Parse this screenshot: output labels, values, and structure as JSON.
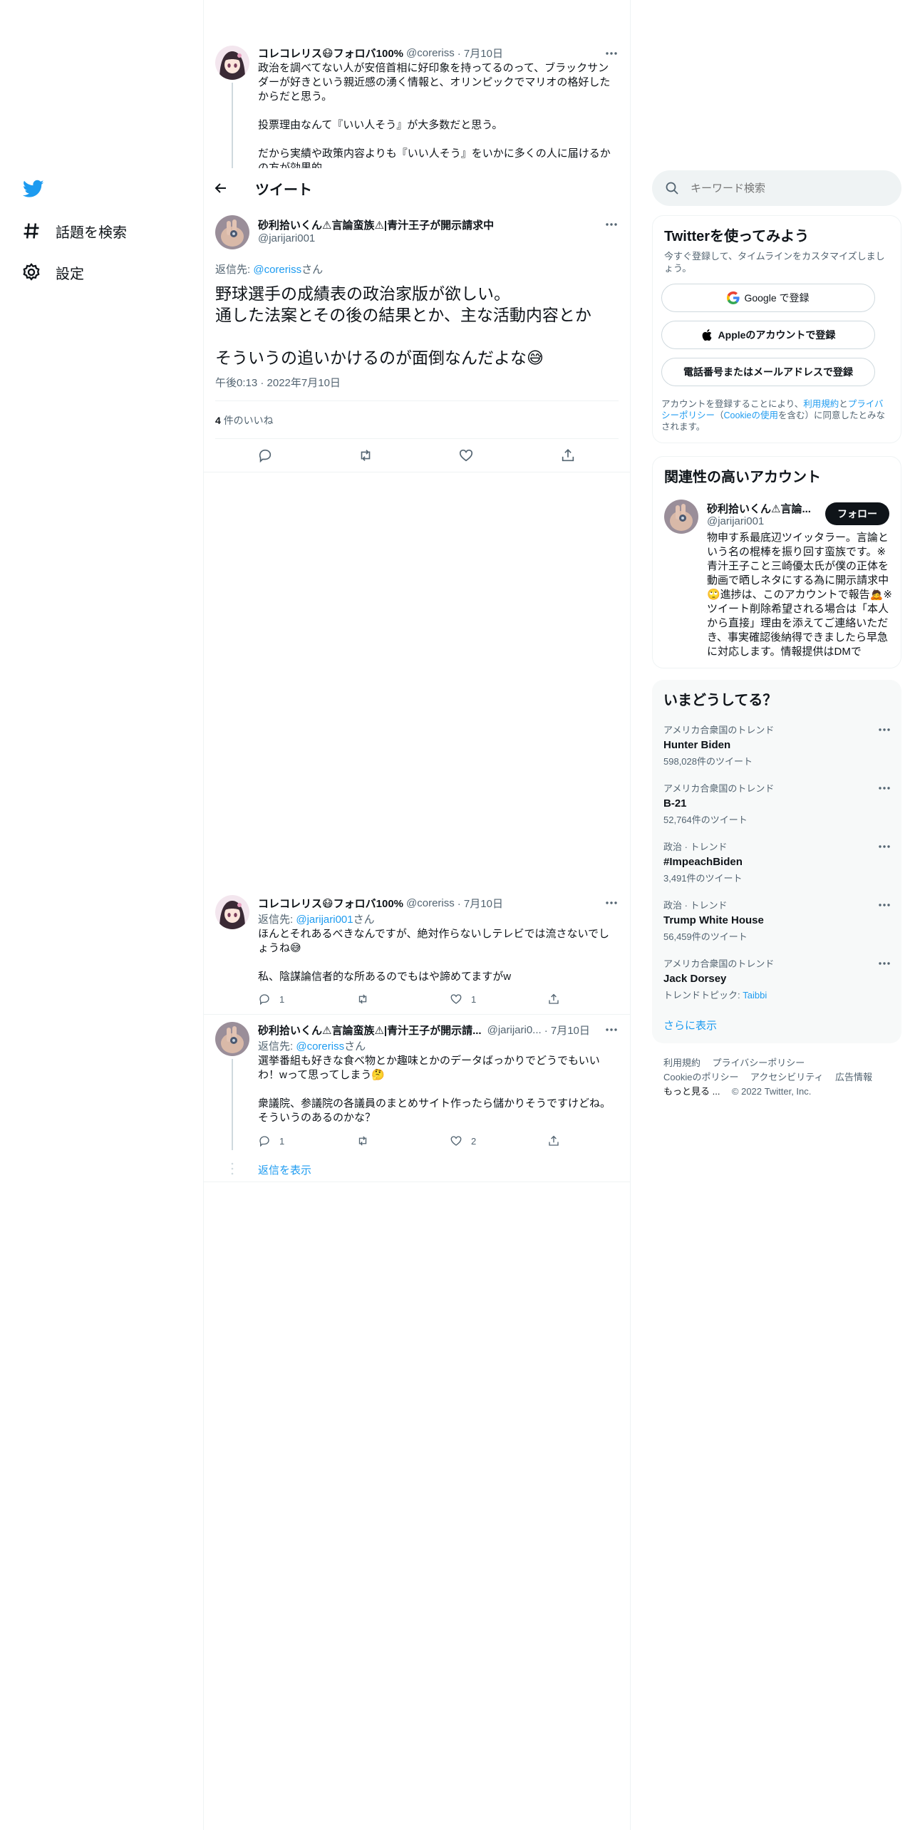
{
  "nav": {
    "explore_label": "話題を検索",
    "settings_label": "設定"
  },
  "header": {
    "title": "ツイート"
  },
  "parent_tweet": {
    "name": "コレコレリス😷フォロバ100%",
    "handle": "@coreriss",
    "date": "· 7月10日",
    "text": "政治を調べてない人が安倍首相に好印象を持ってるのって、ブラックサンダーが好きという親近感の湧く情報と、オリンピックでマリオの格好したからだと思う。\n\n投票理由なんて『いい人そう』が大多数だと思う。\n\nだから実績や政策内容よりも『いい人そう』をいかに多くの人に届けるかの方が効果的"
  },
  "main_tweet": {
    "name": "砂利拾いくん⚠言論蛮族⚠|青汁王子が開示請求中",
    "handle": "@jarijari001",
    "reply_label": "返信先:",
    "reply_to": "@coreriss",
    "reply_suffix": "さん",
    "text": "野球選手の成績表の政治家版が欲しい。\n通した法案とその後の結果とか、主な活動内容とか\n\nそういうの追いかけるのが面倒なんだよな😅",
    "timestamp": "午後0:13 · 2022年7月10日",
    "likes_count": "4",
    "likes_label": "件のいいね"
  },
  "replies": [
    {
      "name": "コレコレリス😷フォロバ100%",
      "handle": "@coreriss",
      "date": "· 7月10日",
      "reply_label": "返信先:",
      "reply_to": "@jarijari001",
      "reply_suffix": "さん",
      "text": "ほんとそれあるべきなんですが、絶対作らないしテレビでは流さないでしょうね😅\n\n私、陰謀論信者的な所あるのでもはや諦めてますがw",
      "reply_count": "1",
      "retweet_count": "",
      "like_count": "1"
    },
    {
      "name": "砂利拾いくん⚠言論蛮族⚠|青汁王子が開示請...",
      "handle": "@jarijari0...",
      "date": "· 7月10日",
      "reply_label": "返信先:",
      "reply_to": "@coreriss",
      "reply_suffix": "さん",
      "text": "選挙番組も好きな食べ物とか趣味とかのデータばっかりでどうでもいいわ！wって思ってしまう🤔\n\n衆議院、参議院の各議員のまとめサイト作ったら儲かりそうですけどね。そういうのあるのかな？",
      "reply_count": "1",
      "retweet_count": "",
      "like_count": "2"
    }
  ],
  "show_replies_label": "返信を表示",
  "search": {
    "placeholder": "キーワード検索"
  },
  "signup": {
    "title": "Twitterを使ってみよう",
    "subtitle": "今すぐ登録して、タイムラインをカスタマイズしましょう。",
    "google_label": "Google で登録",
    "apple_label": "Appleのアカウントで登録",
    "phone_label": "電話番号またはメールアドレスで登録",
    "terms_prefix": "アカウントを登録することにより、",
    "terms_link": "利用規約",
    "terms_and": "と",
    "privacy_link": "プライバシーポリシー",
    "cookie_open": "（",
    "cookie_link": "Cookieの使用",
    "terms_suffix": "を含む）に同意したとみなされます。"
  },
  "related": {
    "title": "関連性の高いアカウント",
    "name": "砂利拾いくん⚠言論...",
    "handle": "@jarijari001",
    "follow_label": "フォロー",
    "bio": "物申す系最底辺ツイッタラー。言論という名の棍棒を振り回す蛮族です。※青汁王子こと三崎優太氏が僕の正体を動画で晒しネタにする為に開示請求中🙄進捗は、このアカウントで報告🙇※ツイート削除希望される場合は「本人から直接」理由を添えてご連絡いただき、事実確認後納得できましたら早急に対応します。情報提供はDMで"
  },
  "trends": {
    "title": "いまどうしてる？",
    "items": [
      {
        "category": "アメリカ合衆国のトレンド",
        "name": "Hunter Biden",
        "count": "598,028件のツイート"
      },
      {
        "category": "アメリカ合衆国のトレンド",
        "name": "B-21",
        "count": "52,764件のツイート"
      },
      {
        "category": "政治 · トレンド",
        "name": "#ImpeachBiden",
        "count": "3,491件のツイート"
      },
      {
        "category": "政治 · トレンド",
        "name": "Trump White House",
        "count": "56,459件のツイート"
      },
      {
        "category": "アメリカ合衆国のトレンド",
        "name": "Jack Dorsey",
        "count_prefix": "トレンドトピック: ",
        "count_link": "Taibbi"
      }
    ],
    "show_more": "さらに表示"
  },
  "footer": {
    "links": [
      "利用規約",
      "プライバシーポリシー",
      "Cookieのポリシー",
      "アクセシビリティ",
      "広告情報"
    ],
    "more": "もっと見る ...",
    "copyright": "© 2022 Twitter, Inc."
  },
  "colors": {
    "accent": "#1d9bf0",
    "text": "#0f1419",
    "muted": "#536471",
    "border": "#eff3f4",
    "panel_bg": "#f7f9f9"
  }
}
